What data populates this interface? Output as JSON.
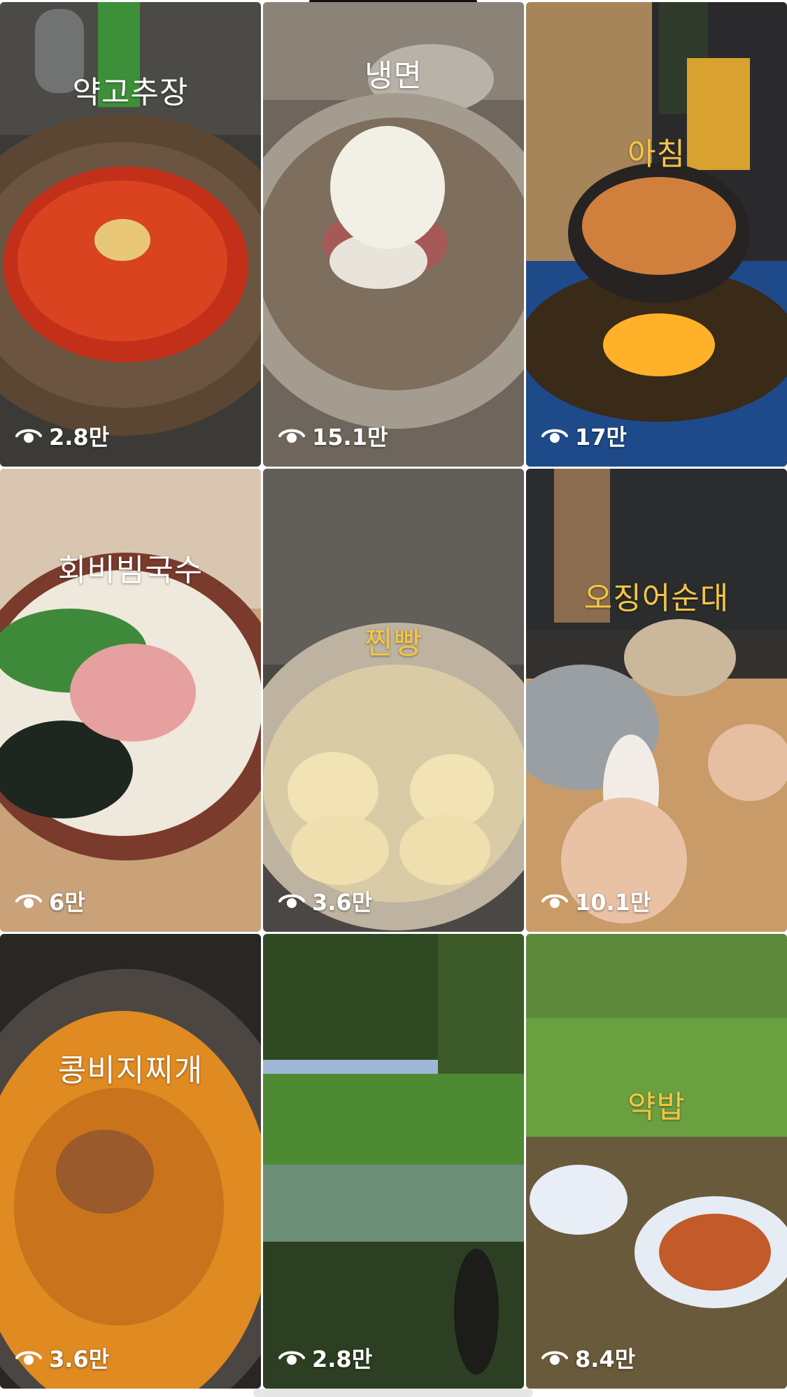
{
  "colors": {
    "title_white": "#ffffff",
    "title_yellow": "#f4c545",
    "views_text": "#ffffff"
  },
  "icons": {
    "views": "eye-icon"
  },
  "videos": [
    {
      "title": "약고추장",
      "title_color": "#ffffff",
      "views": "2.8만"
    },
    {
      "title": "냉면",
      "title_color": "#ffffff",
      "views": "15.1만"
    },
    {
      "title": "아침",
      "title_color": "#f4c545",
      "views": "17만"
    },
    {
      "title": "회비빔국수",
      "title_color": "#ffffff",
      "views": "6만"
    },
    {
      "title": "찐빵",
      "title_color": "#f4c545",
      "views": "3.6만"
    },
    {
      "title": "오징어순대",
      "title_color": "#f4c545",
      "views": "10.1만"
    },
    {
      "title": "콩비지찌개",
      "title_color": "#ffffff",
      "views": "3.6만"
    },
    {
      "title": "",
      "title_color": "#ffffff",
      "views": "2.8만"
    },
    {
      "title": "약밥",
      "title_color": "#f4c545",
      "views": "8.4만"
    }
  ]
}
